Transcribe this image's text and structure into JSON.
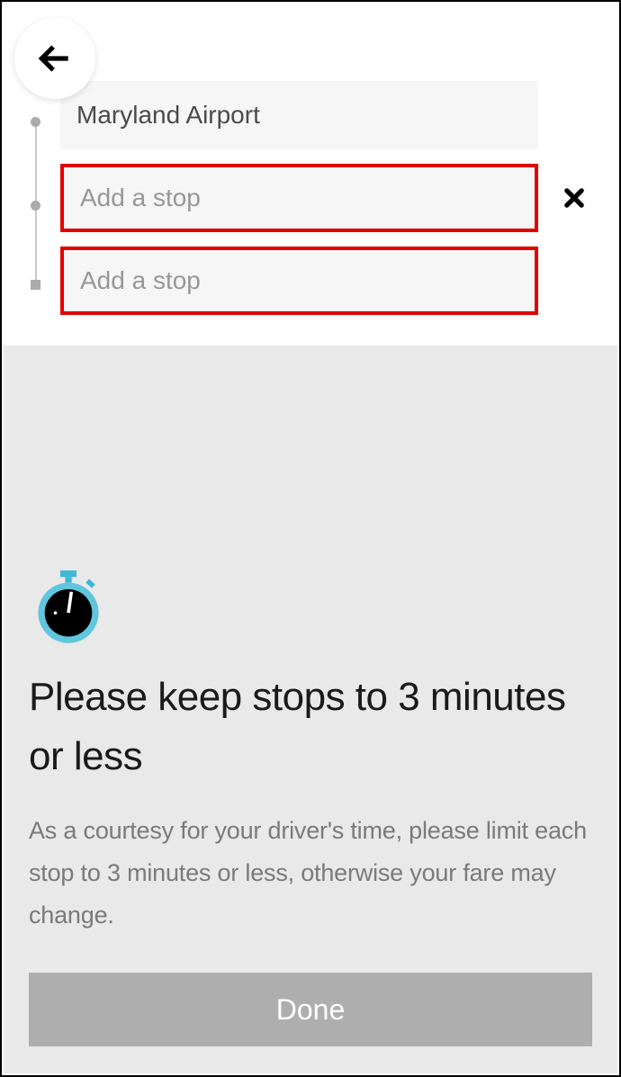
{
  "stops": {
    "origin": "Maryland Airport",
    "stop1_placeholder": "Add a stop",
    "stop2_placeholder": "Add a stop"
  },
  "info": {
    "title": "Please keep stops to 3 minutes or less",
    "body": "As a courtesy for your driver's time, please limit each stop to 3 minutes or less, otherwise your fare may change.",
    "done_label": "Done"
  }
}
